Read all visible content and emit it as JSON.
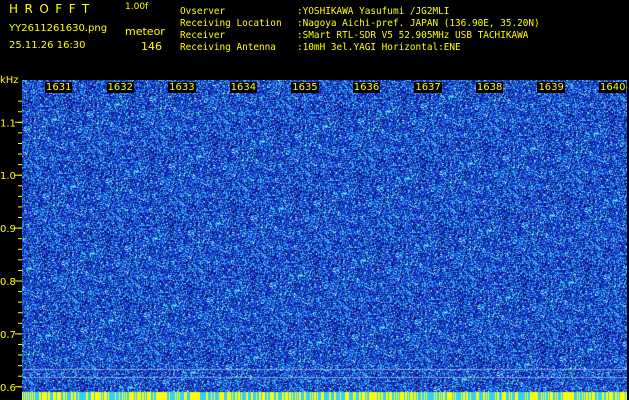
{
  "header": {
    "app_title": "HROFFT",
    "app_version": "1.00f",
    "file_name": "YY2611261630.png",
    "timestamp": "25.11.26 16:30",
    "mode_label": "meteor",
    "count_value": "146"
  },
  "station_info": [
    {
      "key": "Ovserver",
      "value": ":YOSHIKAWA Yasufumi /JG2MLI"
    },
    {
      "key": "Receiving Location",
      "value": ":Nagoya Aichi-pref. JAPAN (136.90E, 35.20N)"
    },
    {
      "key": "Receiver",
      "value": ":SMart RTL-SDR V5 52.905MHz USB TACHIKAWA"
    },
    {
      "key": "Receiving Antenna",
      "value": ":10mH 3el.YAGI Horizontal:ENE"
    }
  ],
  "y_axis": {
    "unit": "kHz",
    "ticks": [
      "1.1",
      "1.0",
      "0.9",
      "0.8",
      "0.7",
      "0.6"
    ],
    "tick_values": [
      1.1,
      1.0,
      0.9,
      0.8,
      0.7,
      0.6
    ],
    "min": 0.575,
    "max": 1.18
  },
  "x_axis": {
    "ticks": [
      "1631",
      "1632",
      "1633",
      "1634",
      "1635",
      "1636",
      "1637",
      "1638",
      "1639",
      "1640"
    ]
  },
  "colors": {
    "text": "#ffff00",
    "background": "#000000",
    "spectrum_base": "#1020a0",
    "spectrum_noise": "#2a48e8",
    "spectrum_bright": "#40e0ff",
    "spectrum_hot": "#ffffff"
  }
}
